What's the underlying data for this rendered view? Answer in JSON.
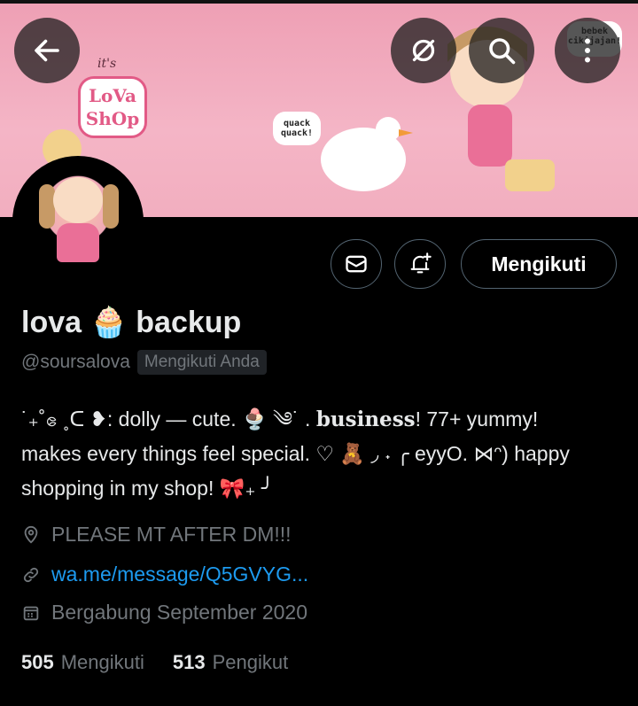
{
  "banner": {
    "its_text": "it's",
    "shop_badge": "LoVa ShOp",
    "quack_bubble": "quack quack!",
    "bebek_bubble": "bebek cikijajan!"
  },
  "header": {
    "back_icon": "arrow-left-icon",
    "grok_icon": "circle-slash-icon",
    "search_icon": "search-icon",
    "more_icon": "more-vertical-icon"
  },
  "actions": {
    "message_icon": "mail-icon",
    "notify_icon": "bell-plus-icon",
    "follow_label": "Mengikuti"
  },
  "profile": {
    "name": "lova 🧁 backup",
    "handle": "@soursalova",
    "follows_you": "Mengikuti Anda",
    "bio_line1_a": "˙₊˚ဧ ˳ᑕ ❥: dolly — cute. 🍨 ༄˙ . ",
    "bio_bold": "business",
    "bio_line1_b": "! 77+ yummy!",
    "bio_line2": "makes every things feel special. ♡ 🧸 ◞ ˖ ╭ eyyO. ⋈ᵔ) happy",
    "bio_line3": "shopping in my shop! 🎀₊ ╯",
    "location": "PLEASE MT AFTER DM!!!",
    "link": "wa.me/message/Q5GVYG...",
    "joined": "Bergabung September 2020"
  },
  "stats": {
    "following_count": "505",
    "following_label": "Mengikuti",
    "followers_count": "513",
    "followers_label": "Pengikut"
  },
  "colors": {
    "accent_link": "#1d9bf0",
    "banner_pink": "#f4b5c6",
    "muted_text": "#71767b"
  }
}
